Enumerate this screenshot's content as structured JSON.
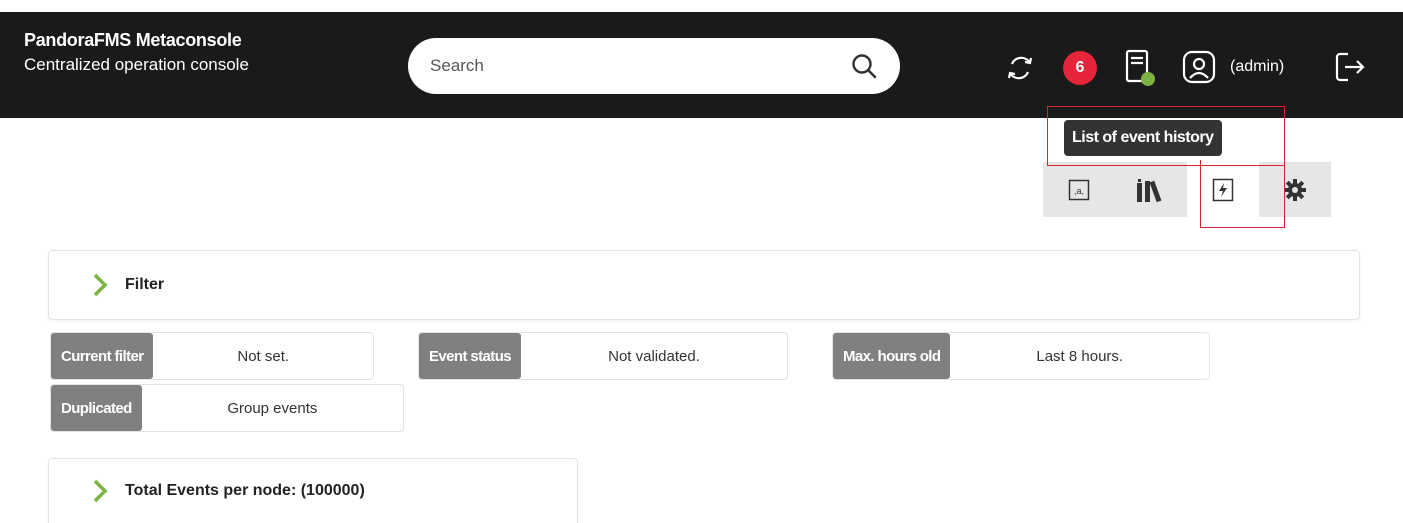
{
  "header": {
    "title": "PandoraFMS Metaconsole",
    "subtitle": "Centralized operation console",
    "search_placeholder": "Search",
    "notification_count": "6",
    "user_label": "(admin)",
    "icons": [
      "refresh-icon",
      "notification-badge",
      "server-status-icon",
      "user-icon",
      "logout-icon"
    ]
  },
  "tooltip": "List of event history",
  "view_tabs": [
    {
      "icon": "text-view-icon",
      "active": false
    },
    {
      "icon": "library-books-icon",
      "active": false
    },
    {
      "icon": "event-history-icon",
      "active": true
    },
    {
      "icon": "gear-icon",
      "active": false
    }
  ],
  "filter_panel": {
    "label": "Filter"
  },
  "filters": [
    {
      "key": "Current filter",
      "value": "Not set."
    },
    {
      "key": "Event status",
      "value": "Not validated."
    },
    {
      "key": "Max. hours old",
      "value": "Last 8 hours."
    },
    {
      "key": "Duplicated",
      "value": "Group events"
    }
  ],
  "total_panel": {
    "label": "Total Events per node: (100000)"
  },
  "colors": {
    "accent_green": "#7cb342",
    "badge_red": "#e6253a",
    "highlight_red": "#d9232e",
    "topbar_dark": "#1a1a1a",
    "chip_key_gray": "#808080"
  }
}
